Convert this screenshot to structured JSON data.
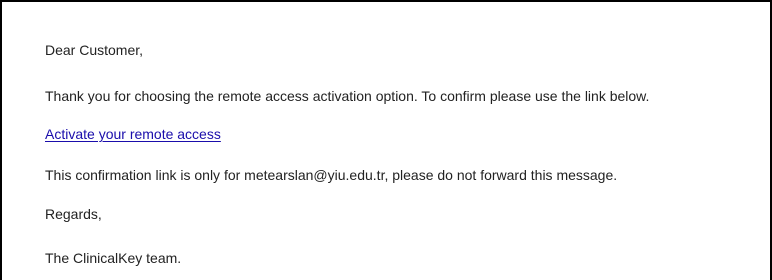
{
  "email": {
    "greeting": "Dear Customer,",
    "intro": "Thank you for choosing the remote access activation option. To confirm please use the link below.",
    "activation_link_label": "Activate your remote access",
    "notice": "This confirmation link is only for metearslan@yiu.edu.tr, please do not forward this message.",
    "closing": "Regards,",
    "signature": "The ClinicalKey team."
  },
  "colors": {
    "text": "#222222",
    "link": "#1a0dab",
    "border": "#000000",
    "background": "#ffffff"
  }
}
